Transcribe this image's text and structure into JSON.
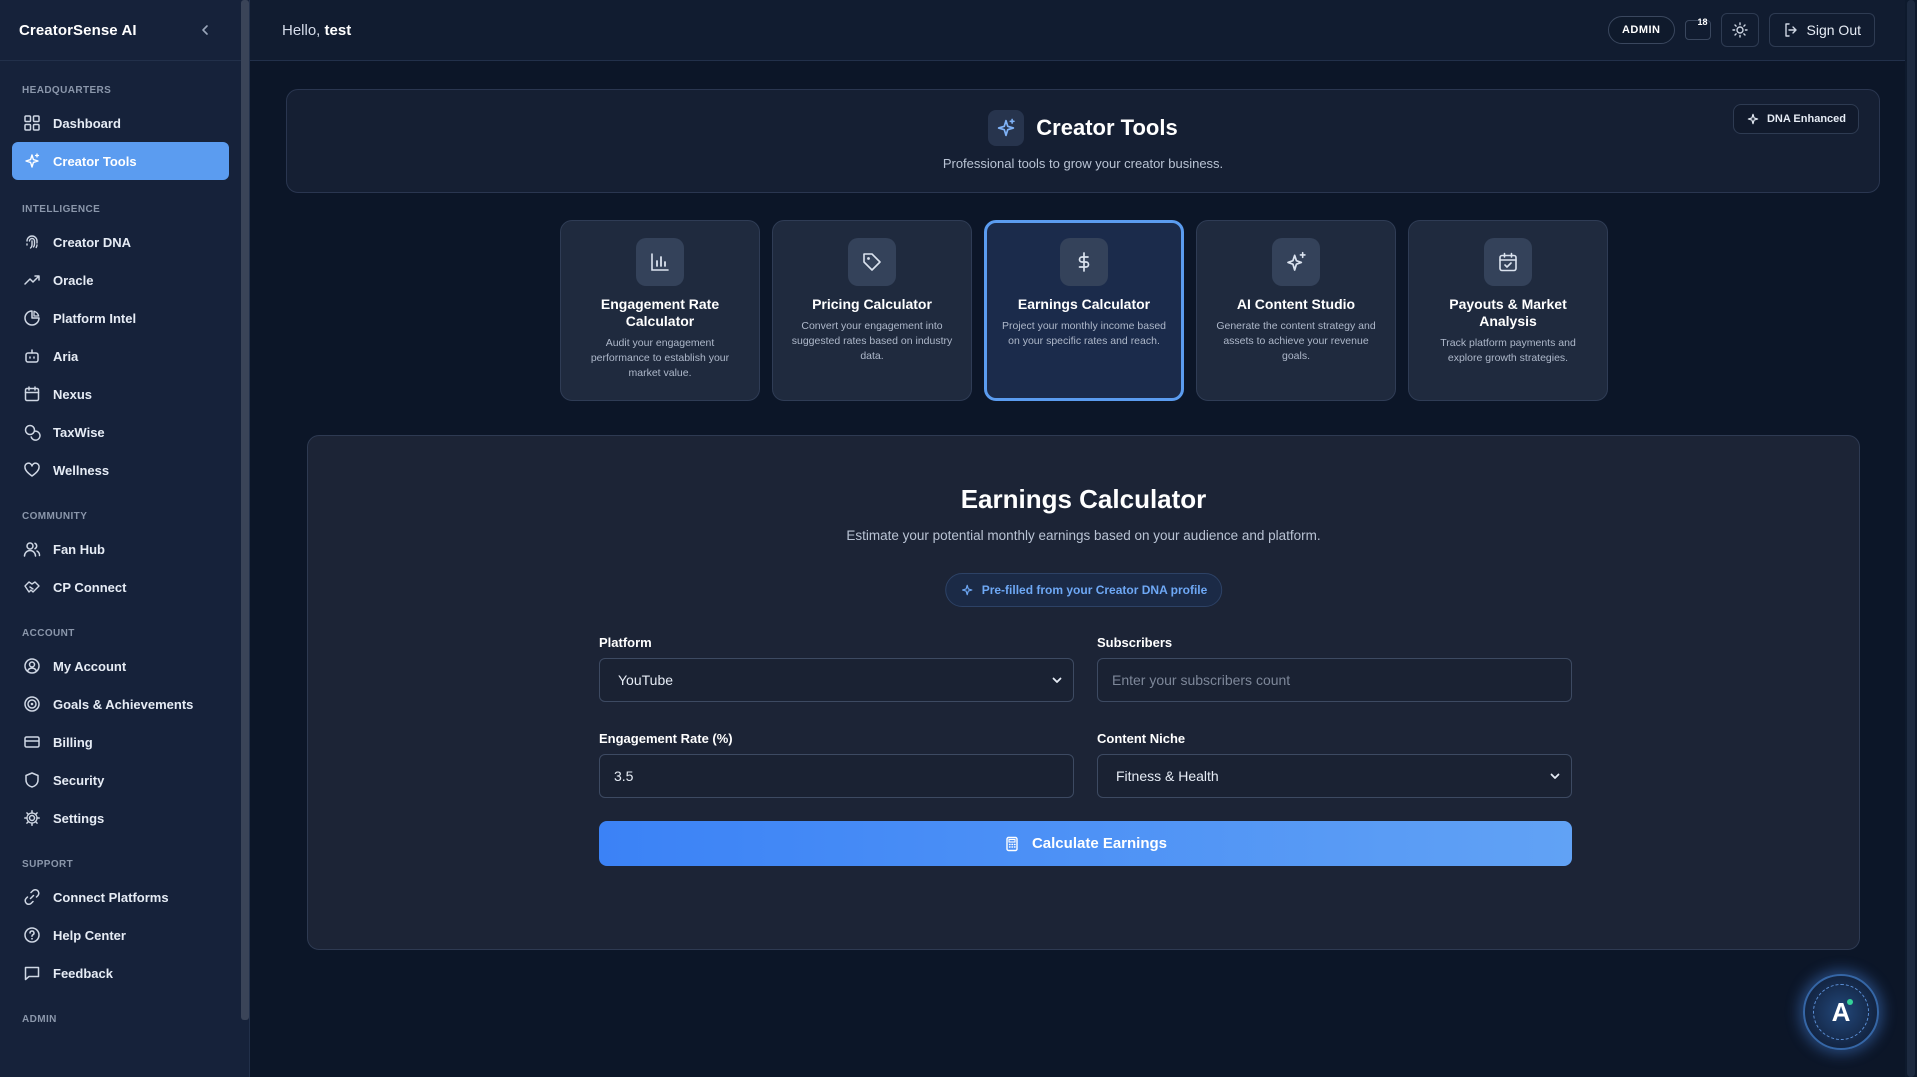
{
  "sidebar": {
    "brand": "CreatorSense AI",
    "sections": {
      "headquarters": "HEADQUARTERS",
      "intelligence": "INTELLIGENCE",
      "community": "COMMUNITY",
      "account": "ACCOUNT",
      "support": "SUPPORT",
      "admin": "ADMIN"
    },
    "items": {
      "dashboard": "Dashboard",
      "creator_tools": "Creator Tools",
      "creator_dna": "Creator DNA",
      "oracle": "Oracle",
      "platform_intel": "Platform Intel",
      "aria": "Aria",
      "nexus": "Nexus",
      "taxwise": "TaxWise",
      "wellness": "Wellness",
      "fan_hub": "Fan Hub",
      "cp_connect": "CP Connect",
      "my_account": "My Account",
      "goals": "Goals & Achievements",
      "billing": "Billing",
      "security": "Security",
      "settings": "Settings",
      "connect_platforms": "Connect Platforms",
      "help_center": "Help Center",
      "feedback": "Feedback"
    },
    "active": "creator_tools"
  },
  "topbar": {
    "greeting_prefix": "Hello,",
    "username": "test",
    "admin_badge": "ADMIN",
    "notification_count": "18",
    "sign_out": "Sign Out"
  },
  "header": {
    "title": "Creator Tools",
    "subtitle": "Professional tools to grow your creator business.",
    "dna_badge": "DNA Enhanced"
  },
  "tools": [
    {
      "title": "Engagement Rate Calculator",
      "desc": "Audit your engagement performance to establish your market value.",
      "icon": "bar-chart-icon"
    },
    {
      "title": "Pricing Calculator",
      "desc": "Convert your engagement into suggested rates based on industry data.",
      "icon": "tag-icon"
    },
    {
      "title": "Earnings Calculator",
      "desc": "Project your monthly income based on your specific rates and reach.",
      "icon": "dollar-icon"
    },
    {
      "title": "AI Content Studio",
      "desc": "Generate the content strategy and assets to achieve your revenue goals.",
      "icon": "sparkles-icon"
    },
    {
      "title": "Payouts & Market Analysis",
      "desc": "Track platform payments and explore growth strategies.",
      "icon": "calendar-check-icon"
    }
  ],
  "selected_tool": "Earnings Calculator",
  "calculator": {
    "title": "Earnings Calculator",
    "subtitle": "Estimate your potential monthly earnings based on your audience and platform.",
    "prefill_note": "Pre-filled from your Creator DNA profile",
    "platform_label": "Platform",
    "platform_value": "YouTube",
    "subscribers_label": "Subscribers",
    "subscribers_placeholder": "Enter your subscribers count",
    "engagement_label": "Engagement Rate (%)",
    "engagement_value": "3.5",
    "niche_label": "Content Niche",
    "niche_value": "Fitness & Health",
    "button_label": "Calculate Earnings"
  },
  "assistant": {
    "letter": "A"
  },
  "colors": {
    "accent": "#5b9cf0",
    "button_start": "#3b82f6",
    "button_end": "#61a2f5",
    "prefill_text": "#6ea8f5",
    "online_dot": "#34d399"
  }
}
